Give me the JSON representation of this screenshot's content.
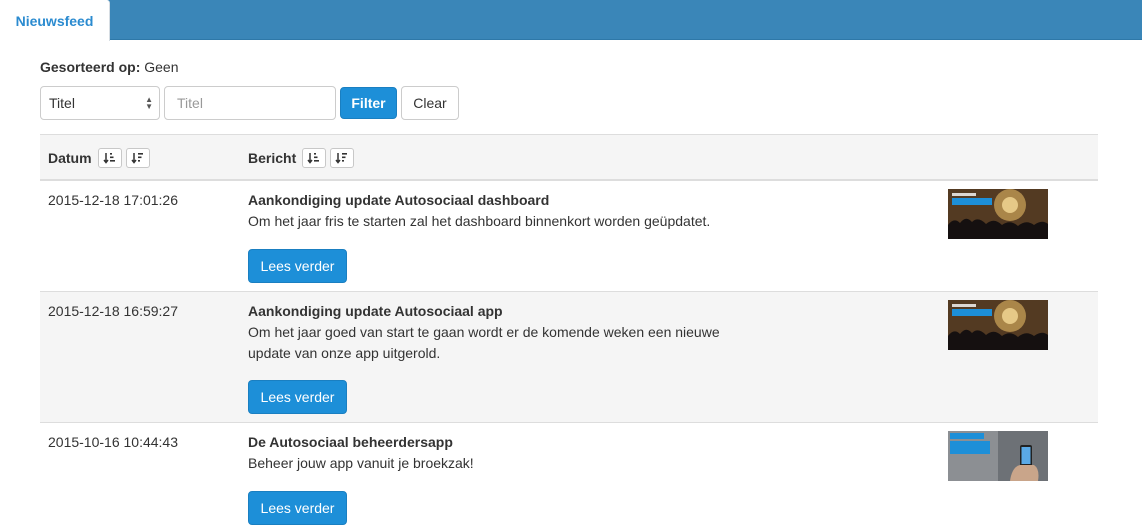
{
  "tabs": [
    {
      "label": "Nieuwsfeed"
    }
  ],
  "sort": {
    "label": "Gesorteerd op:",
    "value": "Geen"
  },
  "filter": {
    "select_value": "Titel",
    "input_placeholder": "Titel",
    "input_value": "",
    "filter_label": "Filter",
    "clear_label": "Clear"
  },
  "table": {
    "columns": [
      "Datum",
      "Bericht"
    ],
    "rows": [
      {
        "date": "2015-12-18 17:01:26",
        "title": "Aankondiging update Autosociaal dashboard",
        "text": "Om het jaar fris te starten zal  het dashboard binnenkort worden geüpdatet.",
        "button": "Lees verder",
        "thumb_icon": "fireworks-crowd-thumbnail"
      },
      {
        "date": "2015-12-18 16:59:27",
        "title": "Aankondiging update Autosociaal app",
        "text": "Om het jaar goed van start te gaan wordt er de komende weken een nieuwe update van onze app uitgerold.",
        "button": "Lees verder",
        "thumb_icon": "fireworks-crowd-thumbnail"
      },
      {
        "date": "2015-10-16 10:44:43",
        "title": "De Autosociaal beheerdersapp",
        "text": "Beheer jouw app vanuit je broekzak!",
        "button": "Lees verder",
        "thumb_icon": "phone-in-hand-thumbnail"
      }
    ]
  },
  "colors": {
    "accent": "#1d8fd8",
    "header_bar": "#3a86b8",
    "row_alt": "#f5f5f5"
  }
}
